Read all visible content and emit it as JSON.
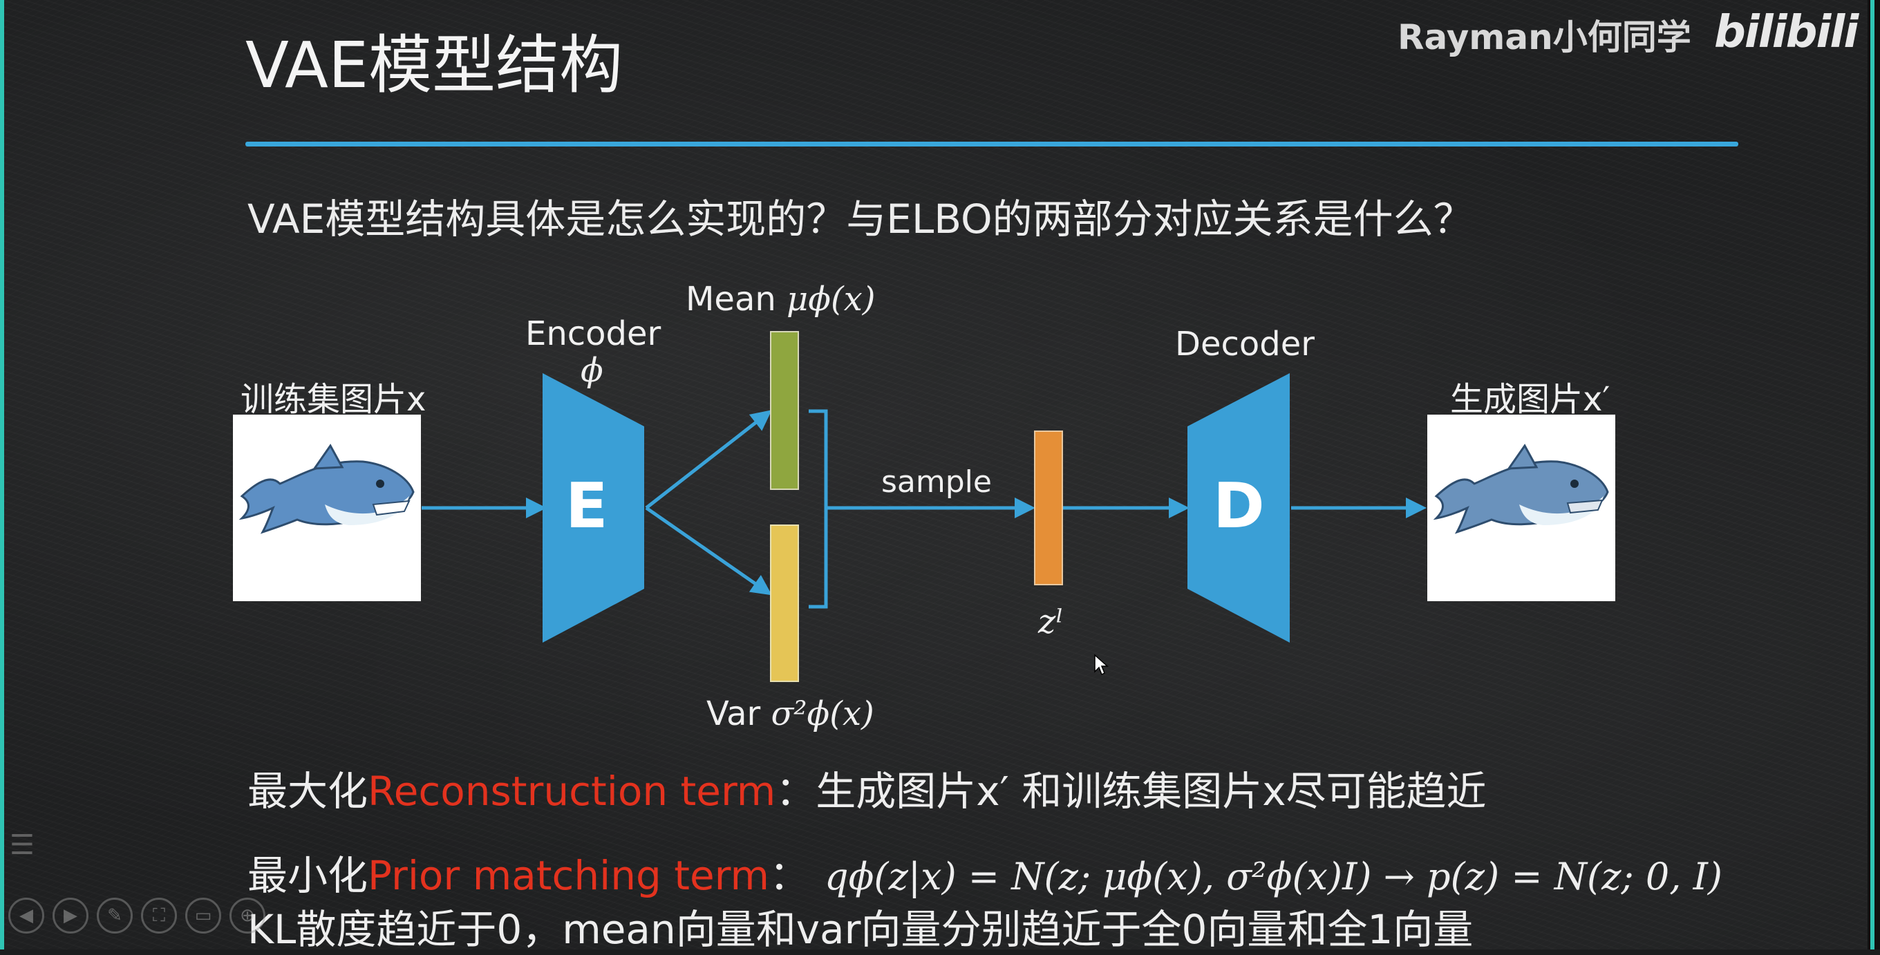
{
  "header": {
    "title": "VAE模型结构",
    "watermark": "Rayman小何同学",
    "logo": "bilibili"
  },
  "question": "VAE模型结构具体是怎么实现的？与ELBO的两部分对应关系是什么？",
  "diagram": {
    "input_label": "训练集图片x",
    "output_label": "生成图片x′",
    "encoder_label": "Encoder",
    "encoder_param": "ϕ",
    "encoder_letter": "E",
    "decoder_label": "Decoder",
    "decoder_letter": "D",
    "mean_prefix": "Mean",
    "mean_math": "μϕ(x)",
    "var_prefix": "Var",
    "var_math": "σ²ϕ(x)",
    "sample_label": "sample",
    "latent_label": "zˡ",
    "colors": {
      "trapezoid": "#3a9fd6",
      "arrow": "#3aa3d9",
      "mean_bar": "#8fa63f",
      "var_bar": "#e5c556",
      "latent_bar": "#e58f37"
    }
  },
  "statements": {
    "line1_prefix": "最大化",
    "line1_term": "Reconstruction term",
    "line1_suffix": "：生成图片x′  和训练集图片x尽可能趋近",
    "line2_prefix": "最小化",
    "line2_term": "Prior matching term",
    "line2_colon": "：",
    "line2_formula": "qϕ(z|x) = N(z; μϕ(x), σ²ϕ(x)I) → p(z) = N(z; 0, I)",
    "line3": "KL散度趋近于0，mean向量和var向量分别趋近于全0向量和全1向量"
  }
}
